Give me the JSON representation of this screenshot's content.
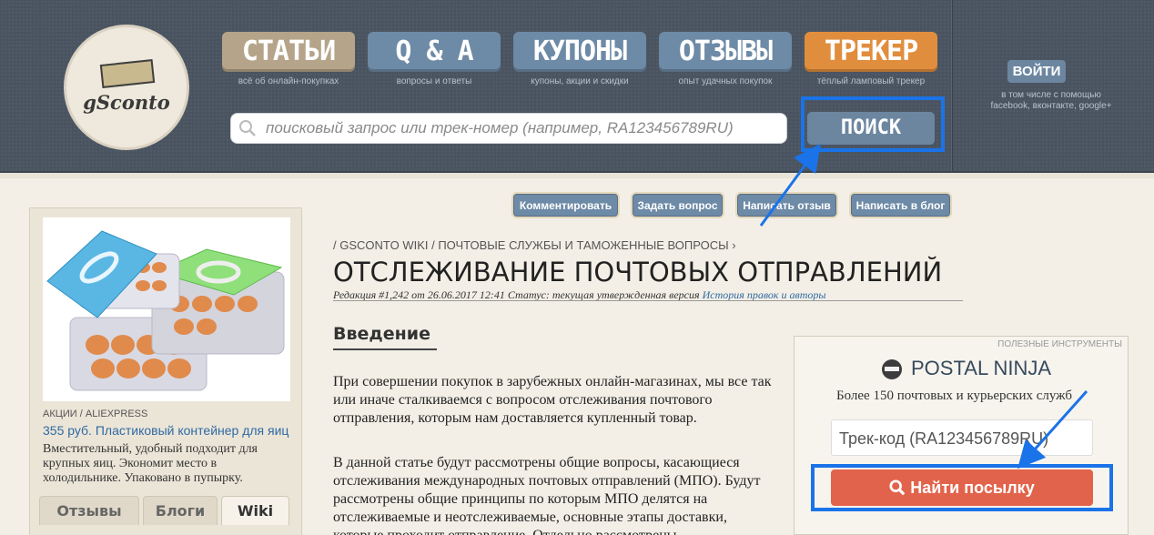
{
  "logo": {
    "text": "gSconto"
  },
  "nav": [
    {
      "label": "СТАТЬИ",
      "sub": "всё об онлайн-покупках"
    },
    {
      "label": "Q & A",
      "sub": "вопросы и ответы"
    },
    {
      "label": "КУПОНЫ",
      "sub": "купоны, акции и скидки"
    },
    {
      "label": "ОТЗЫВЫ",
      "sub": "опыт удачных покупок"
    },
    {
      "label": "ТРЕКЕР",
      "sub": "тёплый ламповый трекер"
    }
  ],
  "search": {
    "placeholder": "поисковый запрос или трек-номер (например, RA123456789RU)",
    "button": "ПОИСК"
  },
  "login": {
    "button": "ВОЙТИ",
    "sub_line1": "в том числе с помощью",
    "sub_line2": "facebook, вконтакте, google+"
  },
  "actions": [
    "Комментировать",
    "Задать вопрос",
    "Написать отзыв",
    "Написать в блог"
  ],
  "sidebar": {
    "category": "АКЦИИ / ALIEXPRESS",
    "title": "355 руб. Пластиковый контейнер для яиц",
    "description": "Вместительный, удобный подходит для крупных яиц. Экономит место в холодильнике. Упаковано в пупырку.",
    "tabs": [
      "Отзывы",
      "Блоги",
      "Wiki"
    ]
  },
  "article": {
    "breadcrumb": "/ GSCONTO WIKI / ПОЧТОВЫЕ СЛУЖБЫ И ТАМОЖЕННЫЕ ВОПРОСЫ ›",
    "title": "ОТСЛЕЖИВАНИЕ ПОЧТОВЫХ ОТПРАВЛЕНИЙ",
    "revision": "Редакция #1,242 от 26.06.2017 12:41 Статус: текущая утвержденная версия",
    "revision_link": "История правок и авторы",
    "section": "Введение",
    "para1": "При совершении покупок в зарубежных онлайн-магазинах, мы все так или иначе сталкиваемся с вопросом отслеживания почтового отправления, которым нам доставляется купленный товар.",
    "para2": "В данной статье будут рассмотрены общие вопросы, касающиеся отслеживания международных почтовых отправлений (МПО). Будут рассмотрены общие принципы по которым МПО делятся на отслеживаемые и неотслеживаемые, основные этапы доставки, которые проходит отправление. Отдельно рассмотрены"
  },
  "widget": {
    "label": "ПОЛЕЗНЫЕ ИНСТРУМЕНТЫ",
    "title": "POSTAL NINJA",
    "subtitle": "Более 150 почтовых и курьерских служб",
    "input_placeholder": "Трек-код (RA123456789RU)",
    "button": "Найти посылку"
  },
  "colors": {
    "highlight": "#1a73e8",
    "find_button": "#e2634b",
    "nav_blue": "#6d8aa6"
  }
}
